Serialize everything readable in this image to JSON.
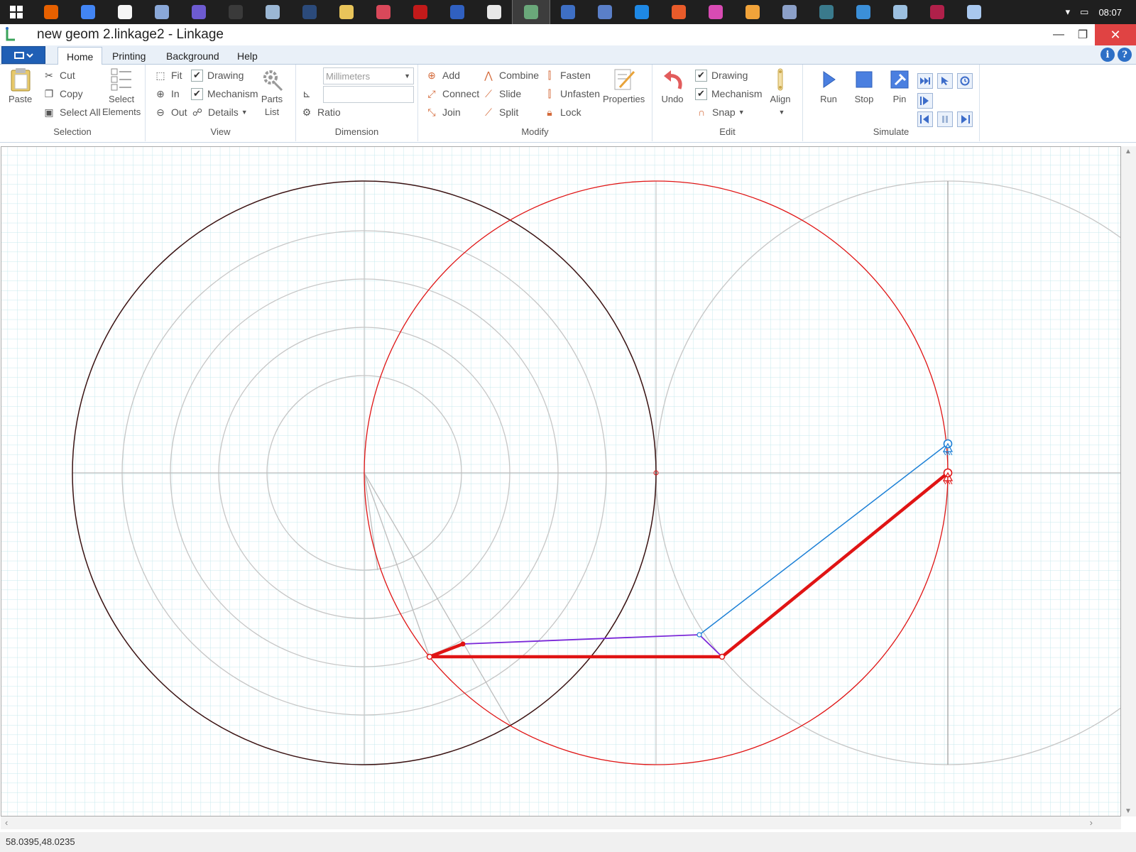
{
  "taskbar": {
    "clock": "08:07",
    "icons": [
      "firefox-icon",
      "chrome-icon",
      "document-icon",
      "network-icon",
      "rv-icon",
      "autocad-icon",
      "search-icon",
      "terminal-icon",
      "folder-icon",
      "pdf-icon",
      "acrobat-icon",
      "settings-gear-icon",
      "cube-icon",
      "linkage-app-icon",
      "browser-icon",
      "shield-icon",
      "inkscape-icon",
      "paint-icon",
      "magic-icon",
      "pencil-icon",
      "map-icon",
      "boat-icon",
      "cubes-icon",
      "film-icon",
      "calculator-icon",
      "puzzle-icon"
    ]
  },
  "window": {
    "title": "new geom 2.linkage2 - Linkage",
    "minimize": "—",
    "maximize": "❐",
    "close": "✕"
  },
  "tabs": [
    "Home",
    "Printing",
    "Background",
    "Help"
  ],
  "help_icons": [
    "i",
    "?"
  ],
  "ribbon": {
    "selection": {
      "label": "Selection",
      "paste": "Paste",
      "cut": "Cut",
      "copy": "Copy",
      "select_all": "Select All",
      "select_elements": [
        "Select",
        "Elements"
      ]
    },
    "view": {
      "label": "View",
      "fit": "Fit",
      "zoom_in": "In",
      "zoom_out": "Out",
      "drawing": "Drawing",
      "mechanism": "Mechanism",
      "details": "Details",
      "parts_list": [
        "Parts",
        "List"
      ]
    },
    "dimension": {
      "label": "Dimension",
      "units_value": "Millimeters",
      "ratio": "Ratio"
    },
    "modify": {
      "label": "Modify",
      "add": "Add",
      "connect": "Connect",
      "join": "Join",
      "combine": "Combine",
      "slide": "Slide",
      "split": "Split",
      "fasten": "Fasten",
      "unfasten": "Unfasten",
      "lock": "Lock",
      "properties": "Properties"
    },
    "edit": {
      "label": "Edit",
      "undo": "Undo",
      "drawing": "Drawing",
      "mechanism": "Mechanism",
      "snap": "Snap",
      "align": "Align"
    },
    "simulate": {
      "label": "Simulate",
      "run": "Run",
      "stop": "Stop",
      "pin": "Pin"
    }
  },
  "canvas": {
    "grid_color": "#bfe6ea",
    "circle_gray": "#c6c6c6",
    "circle_dark": "#3a1212",
    "red": "#e01414",
    "blue": "#1b7fd6",
    "purple": "#7a28d8"
  },
  "statusbar": {
    "coordinates": "58.0395,48.0235"
  }
}
